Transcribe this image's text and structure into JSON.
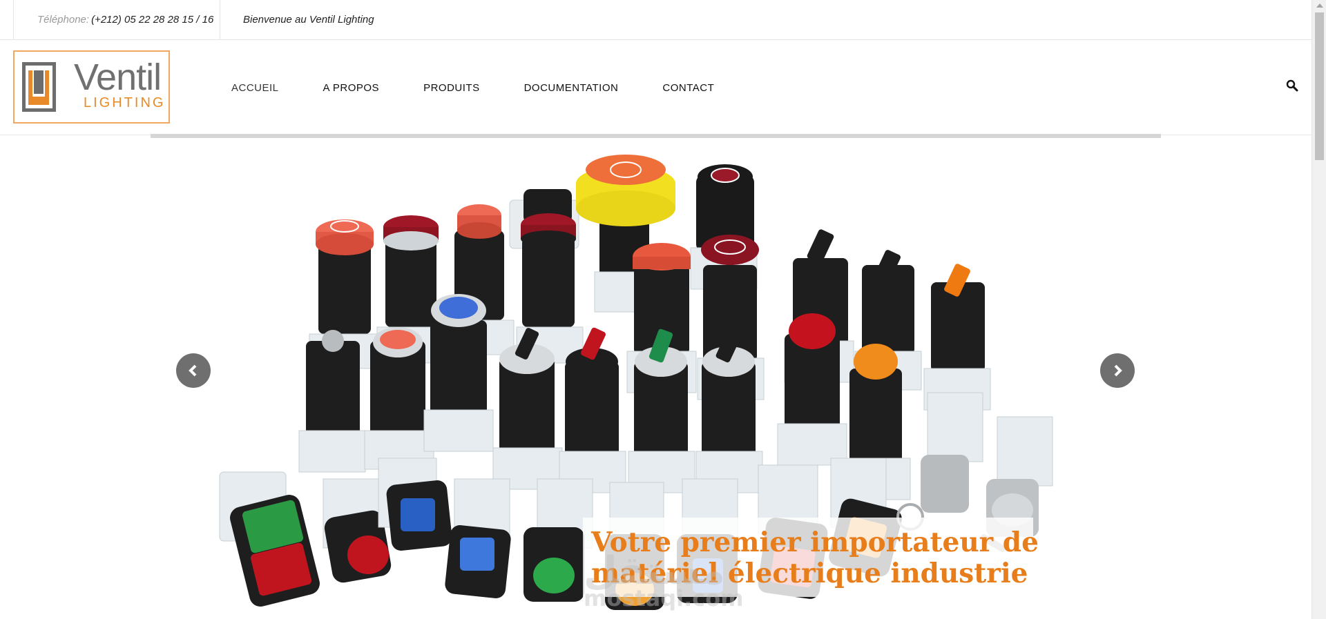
{
  "topbar": {
    "phone_label": "Téléphone:",
    "phone_number": "(+212) 05 22 28 28 15 / 16",
    "welcome": "Bienvenue au Ventil Lighting"
  },
  "logo": {
    "word": "Ventil",
    "sub": "LIGHTING"
  },
  "nav": {
    "items": [
      {
        "label": "ACCUEIL"
      },
      {
        "label": "A PROPOS"
      },
      {
        "label": "PRODUITS"
      },
      {
        "label": "DOCUMENTATION"
      },
      {
        "label": "CONTACT"
      }
    ]
  },
  "slider": {
    "caption_line1": "Votre premier importateur de",
    "caption_line2": "matériel électrique industrie",
    "prev_icon": "chevron-left-icon",
    "next_icon": "chevron-right-icon"
  },
  "watermark": {
    "arabic": "مستقل",
    "latin": "mostaqi.com"
  },
  "colors": {
    "accent": "#e87e1b",
    "logo_border": "#f0a860",
    "arrow_bg": "#6f6f6f"
  }
}
